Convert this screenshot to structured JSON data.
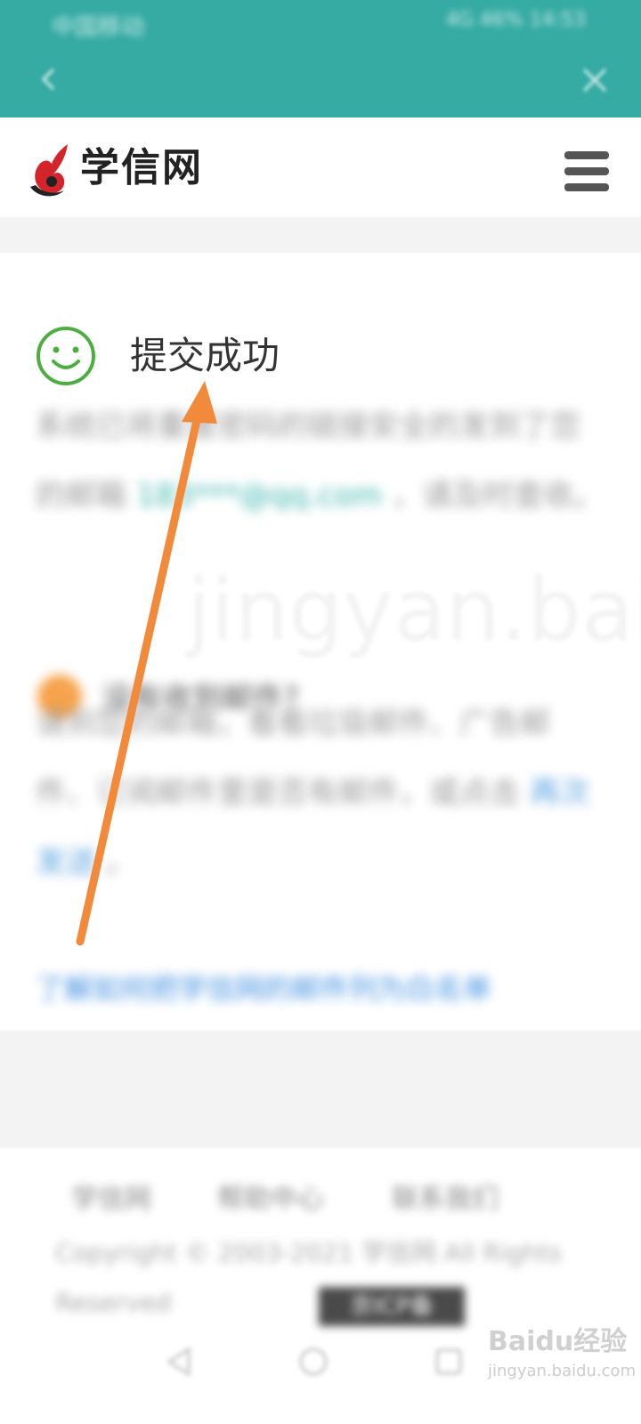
{
  "status_bar": {
    "left_text": "中国移动",
    "right_text": "4G 46% 14:53"
  },
  "nav": {
    "back_icon": "chevron-left-icon",
    "close_icon": "close-icon"
  },
  "header": {
    "logo_icon": "xuexin-bird-logo",
    "brand_name": "学信网",
    "menu_icon": "hamburger-menu-icon"
  },
  "result": {
    "icon": "smile-icon",
    "title": "提交成功",
    "message_part1": "系统已将重置密码的链接安全的发到了您的邮箱 ",
    "email": "183***@qq.com",
    "message_part2": " ，请及时查收。"
  },
  "notice": {
    "icon": "info-dot-icon",
    "title": "没有收到邮件?",
    "body_part1": "请到您的邮箱，看看垃圾邮件、广告邮件、订阅邮件里是否有邮件，或点击 ",
    "retry_link": "再次发送",
    "body_part2": " 。",
    "learn_link": "了解如何把学信网的邮件列为白名单"
  },
  "footer": {
    "links": [
      "学信网",
      "帮助中心",
      "联系我们"
    ],
    "copyright": "Copyright © 2003-2021 学信网 All Rights Reserved",
    "beian_button": "京ICP备"
  },
  "system_nav": {
    "back_icon": "triangle-back-icon",
    "home_icon": "circle-home-icon",
    "recent_icon": "square-recent-icon"
  },
  "watermark": {
    "brand": "Baidu经验",
    "url": "jingyan.baidu.com"
  },
  "annotation": {
    "arrow_color": "#f28a3c"
  }
}
